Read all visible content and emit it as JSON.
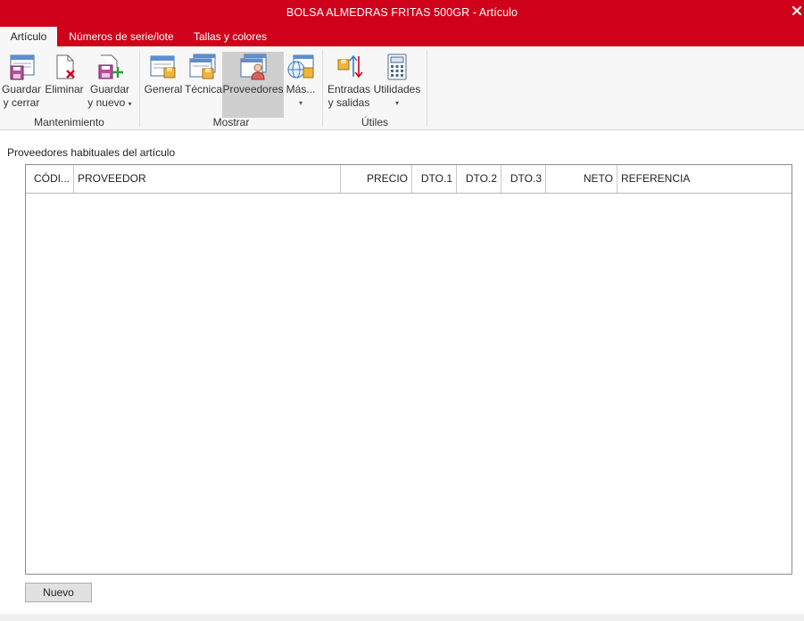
{
  "window": {
    "title": "BOLSA ALMEDRAS FRITAS 500GR - Artículo",
    "close_glyph": "✕",
    "accent": "#d0021b"
  },
  "tabs": [
    {
      "label": "Artículo",
      "active": true
    },
    {
      "label": "Números de serie/lote",
      "active": false
    },
    {
      "label": "Tallas y colores",
      "active": false
    }
  ],
  "ribbon": {
    "groups": {
      "mantenimiento": "Mantenimiento",
      "mostrar": "Mostrar",
      "utiles": "Útiles"
    },
    "buttons": {
      "guardar_cerrar": {
        "line1": "Guardar",
        "line2": "y cerrar",
        "icon": "save-close-icon"
      },
      "eliminar": {
        "line1": "Eliminar",
        "icon": "delete-document-icon"
      },
      "guardar_nuevo": {
        "line1": "Guardar",
        "line2": "y nuevo",
        "caret": "▾",
        "icon": "save-new-icon"
      },
      "general": {
        "line1": "General",
        "icon": "general-form-icon"
      },
      "tecnica": {
        "line1": "Técnica",
        "icon": "technical-form-icon"
      },
      "proveedores": {
        "line1": "Proveedores",
        "icon": "suppliers-icon",
        "selected": true
      },
      "mas": {
        "line1": "Más...",
        "caret": "▾",
        "icon": "globe-more-icon"
      },
      "entradas_salidas": {
        "line1": "Entradas",
        "line2": "y salidas",
        "icon": "in-out-arrows-icon"
      },
      "utilidades": {
        "line1": "Utilidades",
        "caret": "▾",
        "icon": "calculator-icon"
      }
    }
  },
  "main": {
    "section_title": "Proveedores habituales del artículo",
    "grid": {
      "columns": [
        "CÓDI...",
        "PROVEEDOR",
        "PRECIO",
        "DTO.1",
        "DTO.2",
        "DTO.3",
        "NETO",
        "REFERENCIA"
      ],
      "rows": []
    },
    "nuevo_button": "Nuevo"
  }
}
